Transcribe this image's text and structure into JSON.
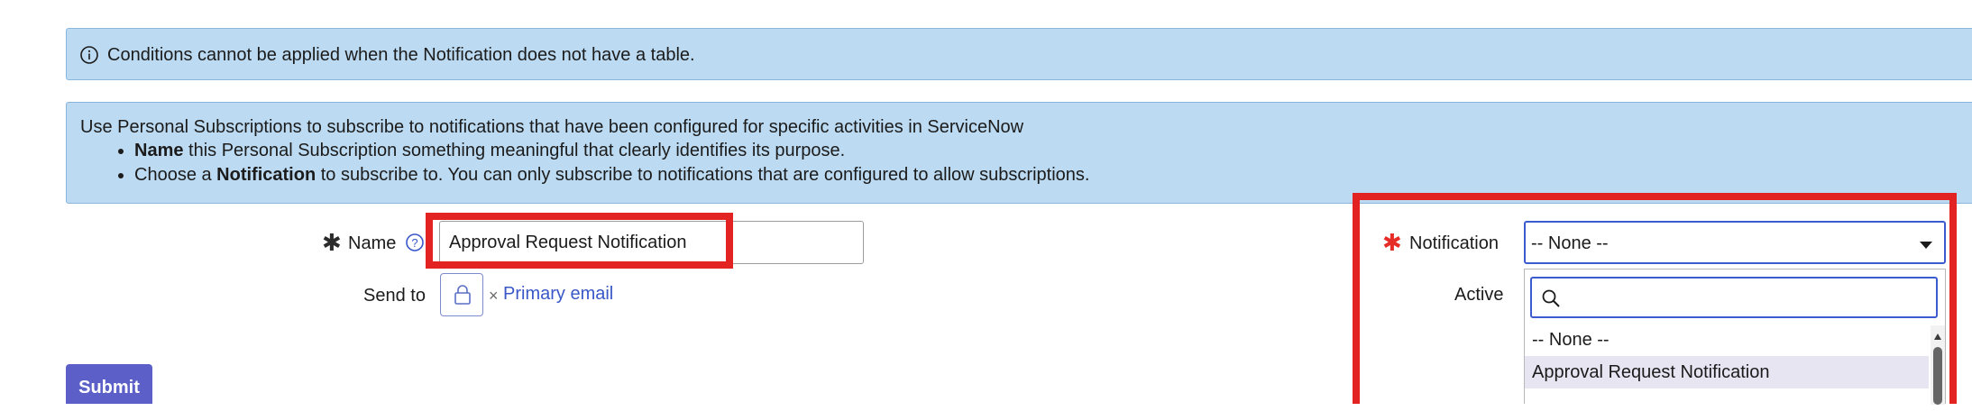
{
  "info_banner": {
    "text": "Conditions cannot be applied when the Notification does not have a table."
  },
  "help_banner": {
    "intro": "Use Personal Subscriptions to subscribe to notifications that have been configured for specific activities in ServiceNow",
    "bullet1_bold": "Name",
    "bullet1_rest": " this Personal Subscription something meaningful that clearly identifies its purpose.",
    "bullet2_pre": "Choose a ",
    "bullet2_bold": "Notification",
    "bullet2_rest": " to subscribe to. You can only subscribe to notifications that are configured to allow subscriptions."
  },
  "form": {
    "name_label": "Name",
    "name_value": "Approval Request Notification",
    "send_to_label": "Send to",
    "send_to_remove": "×",
    "send_to_value": "Primary email",
    "notification_label": "Notification",
    "notification_selected": "-- None --",
    "active_label": "Active",
    "submit_label": "Submit"
  },
  "dropdown": {
    "search_value": "",
    "options": [
      "-- None --",
      "Approval Request Notification"
    ],
    "highlighted_index": 1
  },
  "colors": {
    "banner_bg": "#bcdaf1",
    "highlight_box": "#e32222",
    "link": "#3a57c8",
    "submit_bg": "#5b5fc7",
    "required_star": "#e62c27"
  },
  "icons": [
    "info-icon",
    "help-icon",
    "lock-icon",
    "search-icon",
    "caret-down-icon",
    "scroll-up-icon"
  ]
}
